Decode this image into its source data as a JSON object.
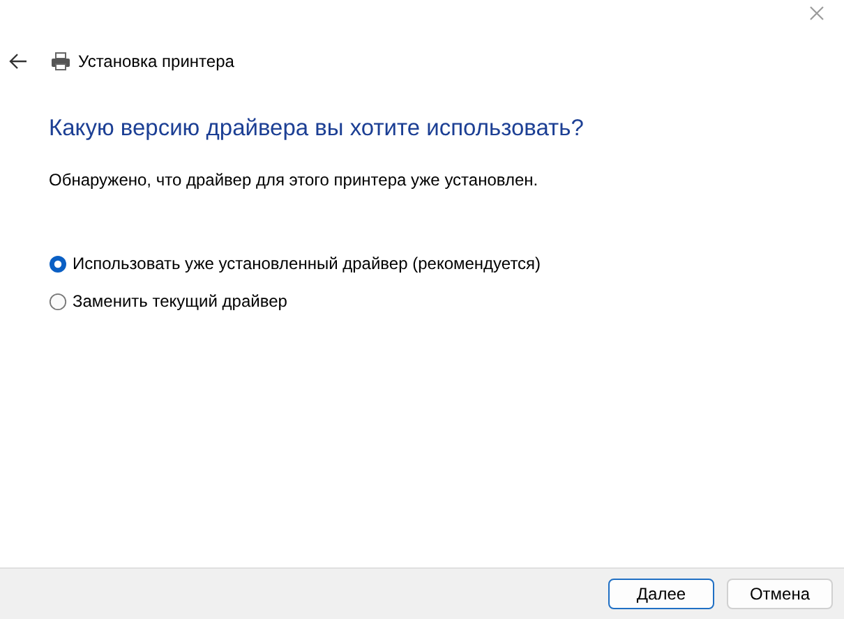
{
  "window": {
    "title": "Установка принтера"
  },
  "heading": "Какую версию драйвера вы хотите использовать?",
  "description": "Обнаружено, что драйвер для этого принтера уже установлен.",
  "options": [
    {
      "label": "Использовать уже установленный драйвер (рекомендуется)",
      "selected": true
    },
    {
      "label": "Заменить текущий драйвер",
      "selected": false
    }
  ],
  "buttons": [
    {
      "label": "Далее",
      "kind": "default"
    },
    {
      "label": "Отмена",
      "kind": "normal"
    }
  ]
}
